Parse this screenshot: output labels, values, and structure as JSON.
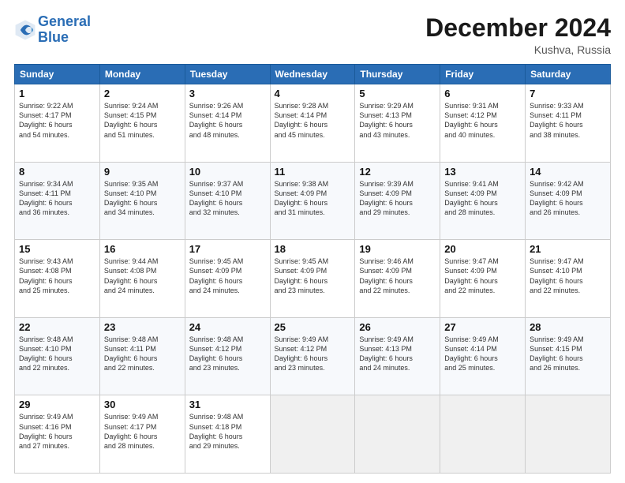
{
  "header": {
    "logo_line1": "General",
    "logo_line2": "Blue",
    "month": "December 2024",
    "location": "Kushva, Russia"
  },
  "days_of_week": [
    "Sunday",
    "Monday",
    "Tuesday",
    "Wednesday",
    "Thursday",
    "Friday",
    "Saturday"
  ],
  "weeks": [
    [
      {
        "day": "1",
        "lines": [
          "Sunrise: 9:22 AM",
          "Sunset: 4:17 PM",
          "Daylight: 6 hours",
          "and 54 minutes."
        ]
      },
      {
        "day": "2",
        "lines": [
          "Sunrise: 9:24 AM",
          "Sunset: 4:15 PM",
          "Daylight: 6 hours",
          "and 51 minutes."
        ]
      },
      {
        "day": "3",
        "lines": [
          "Sunrise: 9:26 AM",
          "Sunset: 4:14 PM",
          "Daylight: 6 hours",
          "and 48 minutes."
        ]
      },
      {
        "day": "4",
        "lines": [
          "Sunrise: 9:28 AM",
          "Sunset: 4:14 PM",
          "Daylight: 6 hours",
          "and 45 minutes."
        ]
      },
      {
        "day": "5",
        "lines": [
          "Sunrise: 9:29 AM",
          "Sunset: 4:13 PM",
          "Daylight: 6 hours",
          "and 43 minutes."
        ]
      },
      {
        "day": "6",
        "lines": [
          "Sunrise: 9:31 AM",
          "Sunset: 4:12 PM",
          "Daylight: 6 hours",
          "and 40 minutes."
        ]
      },
      {
        "day": "7",
        "lines": [
          "Sunrise: 9:33 AM",
          "Sunset: 4:11 PM",
          "Daylight: 6 hours",
          "and 38 minutes."
        ]
      }
    ],
    [
      {
        "day": "8",
        "lines": [
          "Sunrise: 9:34 AM",
          "Sunset: 4:11 PM",
          "Daylight: 6 hours",
          "and 36 minutes."
        ]
      },
      {
        "day": "9",
        "lines": [
          "Sunrise: 9:35 AM",
          "Sunset: 4:10 PM",
          "Daylight: 6 hours",
          "and 34 minutes."
        ]
      },
      {
        "day": "10",
        "lines": [
          "Sunrise: 9:37 AM",
          "Sunset: 4:10 PM",
          "Daylight: 6 hours",
          "and 32 minutes."
        ]
      },
      {
        "day": "11",
        "lines": [
          "Sunrise: 9:38 AM",
          "Sunset: 4:09 PM",
          "Daylight: 6 hours",
          "and 31 minutes."
        ]
      },
      {
        "day": "12",
        "lines": [
          "Sunrise: 9:39 AM",
          "Sunset: 4:09 PM",
          "Daylight: 6 hours",
          "and 29 minutes."
        ]
      },
      {
        "day": "13",
        "lines": [
          "Sunrise: 9:41 AM",
          "Sunset: 4:09 PM",
          "Daylight: 6 hours",
          "and 28 minutes."
        ]
      },
      {
        "day": "14",
        "lines": [
          "Sunrise: 9:42 AM",
          "Sunset: 4:09 PM",
          "Daylight: 6 hours",
          "and 26 minutes."
        ]
      }
    ],
    [
      {
        "day": "15",
        "lines": [
          "Sunrise: 9:43 AM",
          "Sunset: 4:08 PM",
          "Daylight: 6 hours",
          "and 25 minutes."
        ]
      },
      {
        "day": "16",
        "lines": [
          "Sunrise: 9:44 AM",
          "Sunset: 4:08 PM",
          "Daylight: 6 hours",
          "and 24 minutes."
        ]
      },
      {
        "day": "17",
        "lines": [
          "Sunrise: 9:45 AM",
          "Sunset: 4:09 PM",
          "Daylight: 6 hours",
          "and 24 minutes."
        ]
      },
      {
        "day": "18",
        "lines": [
          "Sunrise: 9:45 AM",
          "Sunset: 4:09 PM",
          "Daylight: 6 hours",
          "and 23 minutes."
        ]
      },
      {
        "day": "19",
        "lines": [
          "Sunrise: 9:46 AM",
          "Sunset: 4:09 PM",
          "Daylight: 6 hours",
          "and 22 minutes."
        ]
      },
      {
        "day": "20",
        "lines": [
          "Sunrise: 9:47 AM",
          "Sunset: 4:09 PM",
          "Daylight: 6 hours",
          "and 22 minutes."
        ]
      },
      {
        "day": "21",
        "lines": [
          "Sunrise: 9:47 AM",
          "Sunset: 4:10 PM",
          "Daylight: 6 hours",
          "and 22 minutes."
        ]
      }
    ],
    [
      {
        "day": "22",
        "lines": [
          "Sunrise: 9:48 AM",
          "Sunset: 4:10 PM",
          "Daylight: 6 hours",
          "and 22 minutes."
        ]
      },
      {
        "day": "23",
        "lines": [
          "Sunrise: 9:48 AM",
          "Sunset: 4:11 PM",
          "Daylight: 6 hours",
          "and 22 minutes."
        ]
      },
      {
        "day": "24",
        "lines": [
          "Sunrise: 9:48 AM",
          "Sunset: 4:12 PM",
          "Daylight: 6 hours",
          "and 23 minutes."
        ]
      },
      {
        "day": "25",
        "lines": [
          "Sunrise: 9:49 AM",
          "Sunset: 4:12 PM",
          "Daylight: 6 hours",
          "and 23 minutes."
        ]
      },
      {
        "day": "26",
        "lines": [
          "Sunrise: 9:49 AM",
          "Sunset: 4:13 PM",
          "Daylight: 6 hours",
          "and 24 minutes."
        ]
      },
      {
        "day": "27",
        "lines": [
          "Sunrise: 9:49 AM",
          "Sunset: 4:14 PM",
          "Daylight: 6 hours",
          "and 25 minutes."
        ]
      },
      {
        "day": "28",
        "lines": [
          "Sunrise: 9:49 AM",
          "Sunset: 4:15 PM",
          "Daylight: 6 hours",
          "and 26 minutes."
        ]
      }
    ],
    [
      {
        "day": "29",
        "lines": [
          "Sunrise: 9:49 AM",
          "Sunset: 4:16 PM",
          "Daylight: 6 hours",
          "and 27 minutes."
        ]
      },
      {
        "day": "30",
        "lines": [
          "Sunrise: 9:49 AM",
          "Sunset: 4:17 PM",
          "Daylight: 6 hours",
          "and 28 minutes."
        ]
      },
      {
        "day": "31",
        "lines": [
          "Sunrise: 9:48 AM",
          "Sunset: 4:18 PM",
          "Daylight: 6 hours",
          "and 29 minutes."
        ]
      },
      null,
      null,
      null,
      null
    ]
  ]
}
